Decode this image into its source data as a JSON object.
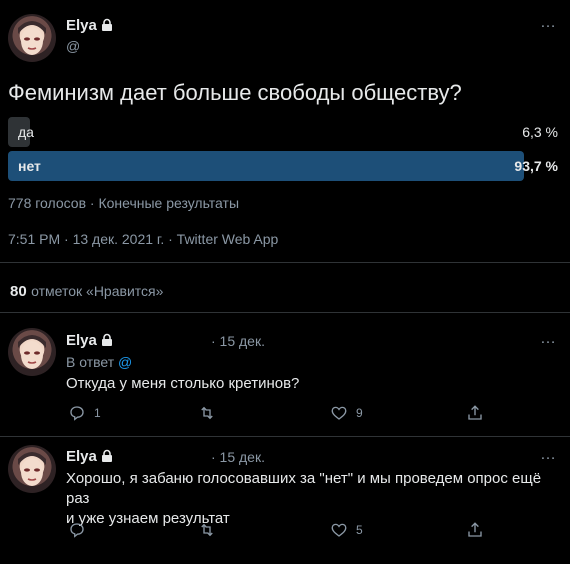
{
  "tweet": {
    "author_name": "Elya",
    "author_handle": "@",
    "question": "Феминизм дает больше свободы обществу?",
    "poll": {
      "options": [
        {
          "label": "да",
          "percent_text": "6,3 %",
          "percent": 6.3,
          "winner": false
        },
        {
          "label": "нет",
          "percent_text": "93,7 %",
          "percent": 93.7,
          "winner": true
        }
      ],
      "summary": "778 голосов · Конечные результаты"
    },
    "timestamp": "7:51 PM · 13 дек. 2021 г. · Twitter Web App",
    "likes": {
      "count": "80",
      "label": "отметок «Нравится»"
    },
    "more_icon": "…"
  },
  "replies": [
    {
      "author_name": "Elya",
      "date": "· 15 дек.",
      "reply_to_prefix": "В ответ",
      "reply_to_handle": "@",
      "text": "Откуда у меня столько кретинов?",
      "replies_count": "1",
      "retweets_count": "",
      "likes_count": "9"
    },
    {
      "author_name": "Elya",
      "date": "· 15 дек.",
      "text_line1": "Хорошо, я забаню голосовавших за \"нет\" и мы проведем опрос ещё раз",
      "text_line2": "и уже узнаем результат",
      "replies_count": "",
      "retweets_count": "",
      "likes_count": "5"
    }
  ],
  "colors": {
    "background": "#000000",
    "text": "#e7e9ea",
    "muted": "#8b98a5",
    "poll_bar": "#2f3336",
    "poll_bar_winner": "#1d4f78",
    "link": "#1d9bf0"
  },
  "icons": [
    "lock-icon",
    "more-icon",
    "reply-icon",
    "retweet-icon",
    "like-icon",
    "share-icon"
  ]
}
